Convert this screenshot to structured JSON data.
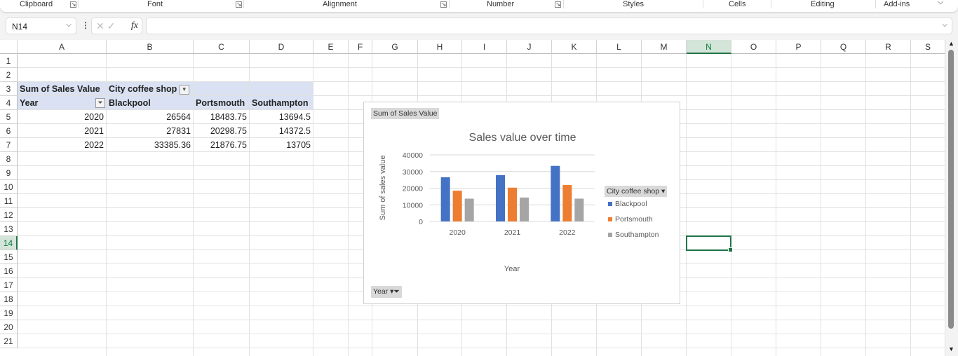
{
  "ribbon": {
    "groups": [
      "Clipboard",
      "Font",
      "Alignment",
      "Number",
      "Styles",
      "Cells",
      "Editing",
      "Add-ins"
    ]
  },
  "formula_bar": {
    "name_box": "N14",
    "formula": "",
    "fx_label": "fx"
  },
  "columns": [
    "A",
    "B",
    "C",
    "D",
    "E",
    "F",
    "G",
    "H",
    "I",
    "J",
    "K",
    "L",
    "M",
    "N",
    "O",
    "P",
    "Q",
    "R",
    "S"
  ],
  "selected_column": "N",
  "selected_row": 14,
  "rows": [
    "1",
    "2",
    "3",
    "4",
    "5",
    "6",
    "7",
    "8",
    "9",
    "10",
    "11",
    "12",
    "13",
    "14",
    "15",
    "16",
    "17",
    "18",
    "19",
    "20",
    "21"
  ],
  "pivot": {
    "value_label": "Sum of Sales Value",
    "column_field": "City coffee shop",
    "row_field": "Year",
    "headers": [
      "Blackpool",
      "Portsmouth",
      "Southampton"
    ],
    "data": [
      [
        "2020",
        "26564",
        "18483.75",
        "13694.5"
      ],
      [
        "2021",
        "27831",
        "20298.75",
        "14372.5"
      ],
      [
        "2022",
        "33385.36",
        "21876.75",
        "13705"
      ]
    ]
  },
  "chart_data": {
    "type": "bar",
    "title": "Sales value over time",
    "xlabel": "Year",
    "ylabel": "Sum of sales value",
    "ylim": [
      0,
      40000
    ],
    "yticks": [
      0,
      10000,
      20000,
      30000,
      40000
    ],
    "grid": true,
    "legend_position": "right",
    "legend_title": "City coffee shop",
    "categories": [
      "2020",
      "2021",
      "2022"
    ],
    "series": [
      {
        "name": "Blackpool",
        "color": "#4472c4",
        "values": [
          26564,
          27831,
          33385.36
        ]
      },
      {
        "name": "Portsmouth",
        "color": "#ed7d31",
        "values": [
          18483.75,
          20298.75,
          21876.75
        ]
      },
      {
        "name": "Southampton",
        "color": "#a5a5a5",
        "values": [
          13694.5,
          14372.5,
          13705
        ]
      }
    ],
    "value_field_button": "Sum of Sales Value",
    "axis_field_button": "Year"
  }
}
